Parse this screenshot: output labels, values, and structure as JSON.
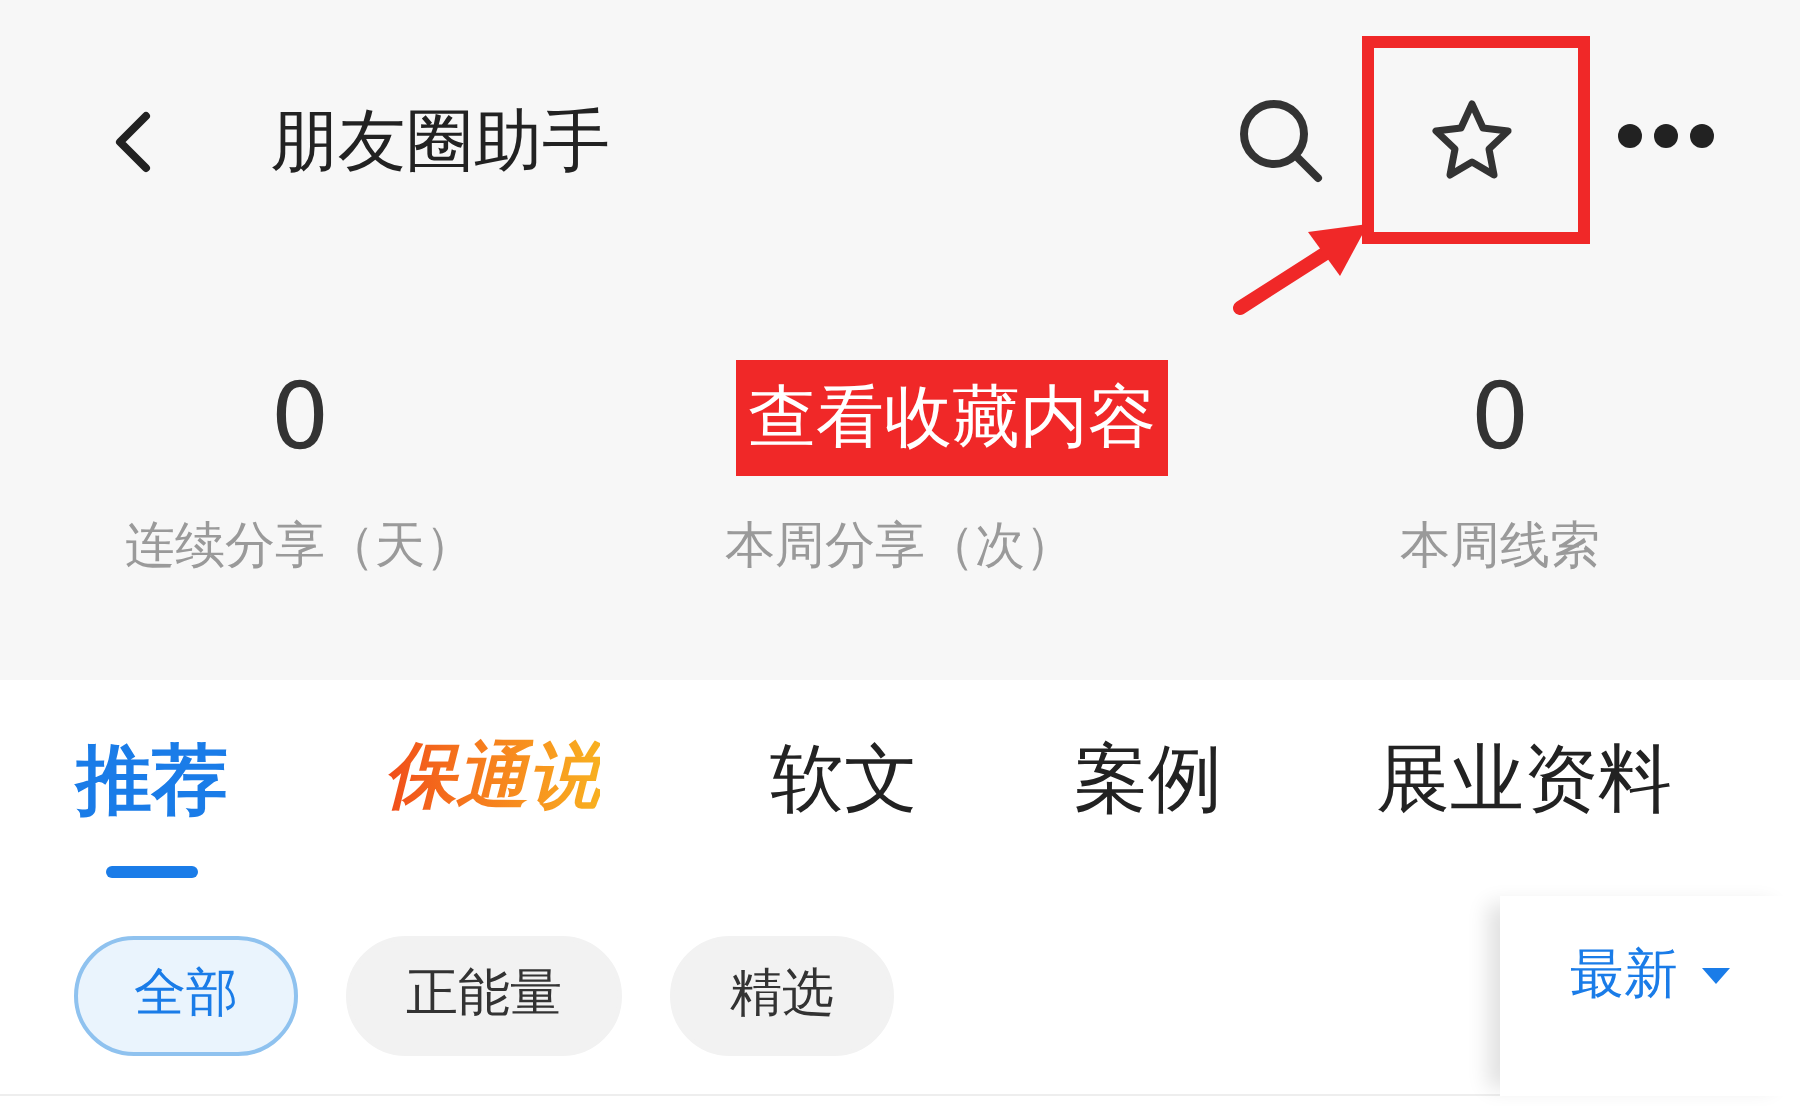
{
  "header": {
    "title": "朋友圈助手"
  },
  "stats": [
    {
      "value": "0",
      "label": "连续分享（天）"
    },
    {
      "label": "本周分享（次）"
    },
    {
      "value": "0",
      "label": "本周线索"
    }
  ],
  "annotation": {
    "label": "查看收藏内容"
  },
  "tabs": [
    {
      "label": "推荐",
      "kind": "text",
      "selected": true
    },
    {
      "label": "保通说",
      "kind": "logo",
      "selected": false
    },
    {
      "label": "软文",
      "kind": "text",
      "selected": false
    },
    {
      "label": "案例",
      "kind": "text",
      "selected": false
    },
    {
      "label": "展业资料",
      "kind": "text",
      "selected": false
    }
  ],
  "filters": [
    {
      "label": "全部",
      "selected": true
    },
    {
      "label": "正能量",
      "selected": false
    },
    {
      "label": "精选",
      "selected": false
    }
  ],
  "sort": {
    "label": "最新"
  }
}
